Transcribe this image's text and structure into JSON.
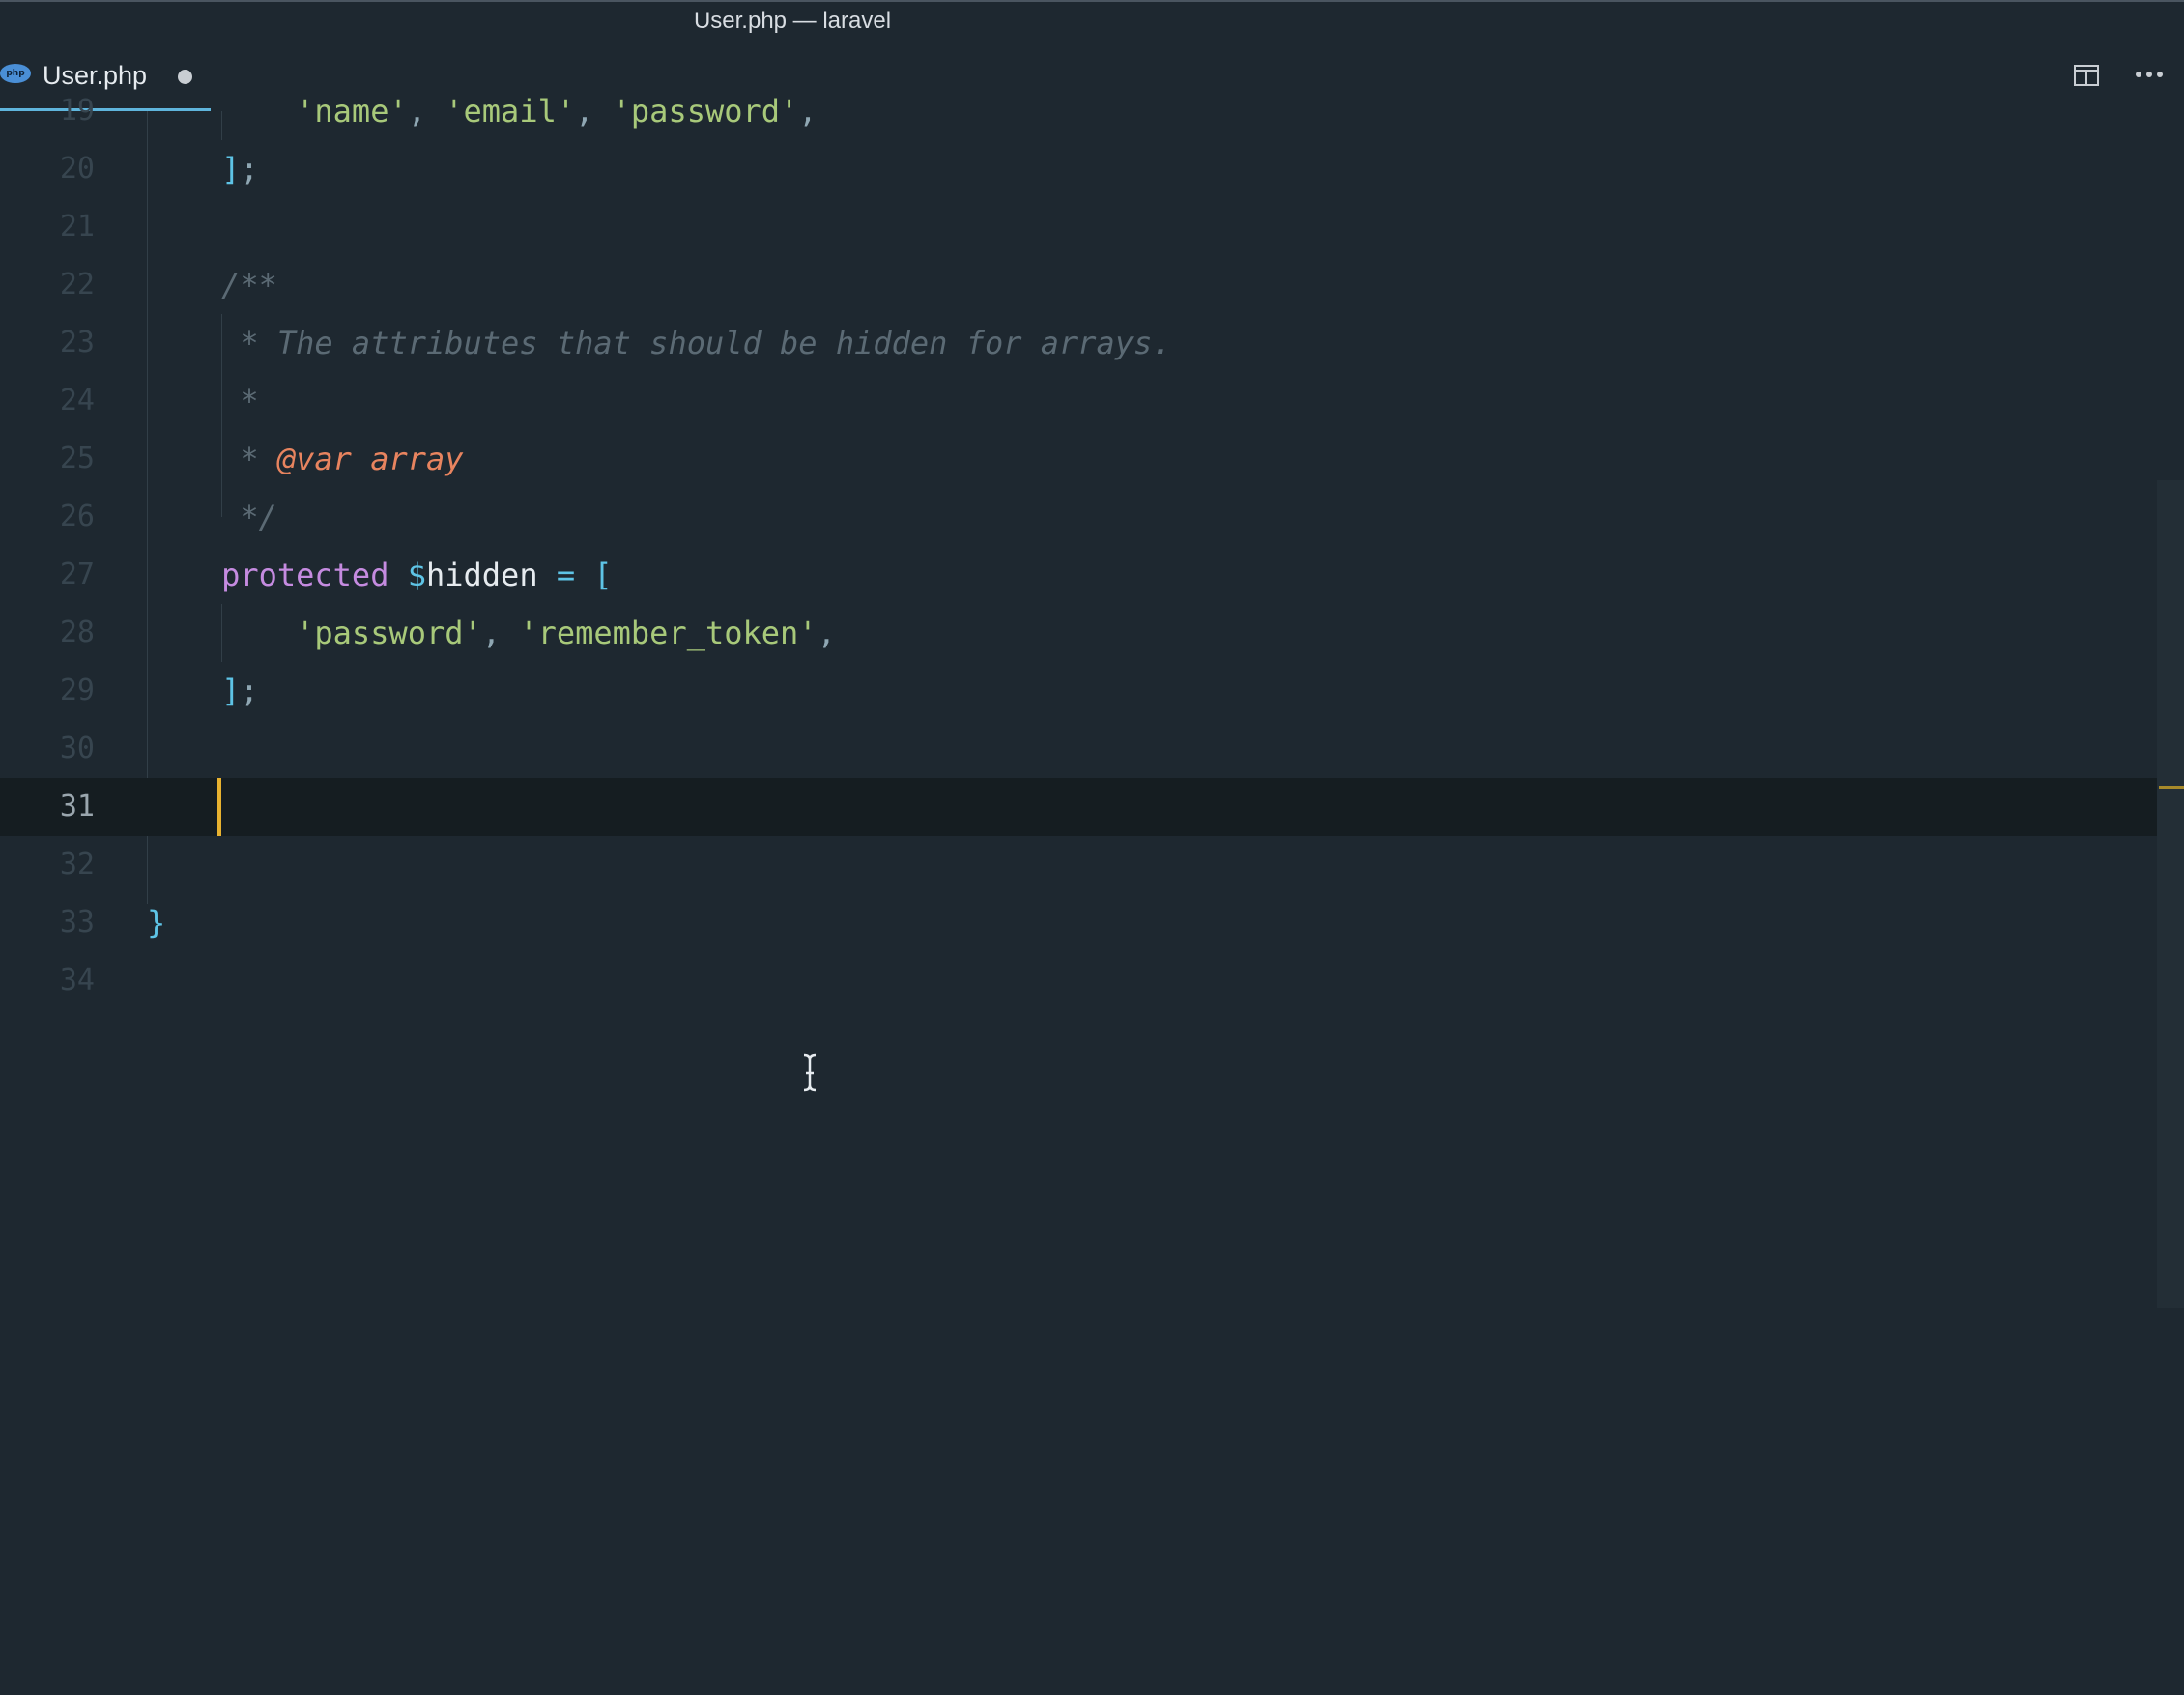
{
  "window": {
    "title": "User.php — laravel"
  },
  "tab": {
    "label": "User.php",
    "icon": "php-file-icon",
    "icon_text": "php",
    "modified": true
  },
  "toolbar": {
    "split_icon": "split-editor-icon",
    "more_icon": "more-actions-icon"
  },
  "editor": {
    "current_line": "31",
    "lines": [
      {
        "num": "19",
        "text": "        'name', 'email', 'password',"
      },
      {
        "num": "20",
        "text": "    ];"
      },
      {
        "num": "21",
        "text": ""
      },
      {
        "num": "22",
        "text": "    /**"
      },
      {
        "num": "23",
        "text": "     * The attributes that should be hidden for arrays."
      },
      {
        "num": "24",
        "text": "     *"
      },
      {
        "num": "25",
        "text": "     * @var array"
      },
      {
        "num": "26",
        "text": "     */"
      },
      {
        "num": "27",
        "text": "    protected $hidden = ["
      },
      {
        "num": "28",
        "text": "        'password', 'remember_token',"
      },
      {
        "num": "29",
        "text": "    ];"
      },
      {
        "num": "30",
        "text": ""
      },
      {
        "num": "31",
        "text": ""
      },
      {
        "num": "32",
        "text": ""
      },
      {
        "num": "33",
        "text": "}"
      },
      {
        "num": "34",
        "text": ""
      }
    ]
  },
  "colors": {
    "background": "#1e2830",
    "current_line": "#151d21",
    "string": "#a8c97a",
    "keyword": "#c58be0",
    "bracket": "#5ec4e6",
    "comment": "#5b6a74",
    "doc_tag": "#e8845f",
    "caret": "#e8b230",
    "tab_underline": "#5fb5dc"
  }
}
